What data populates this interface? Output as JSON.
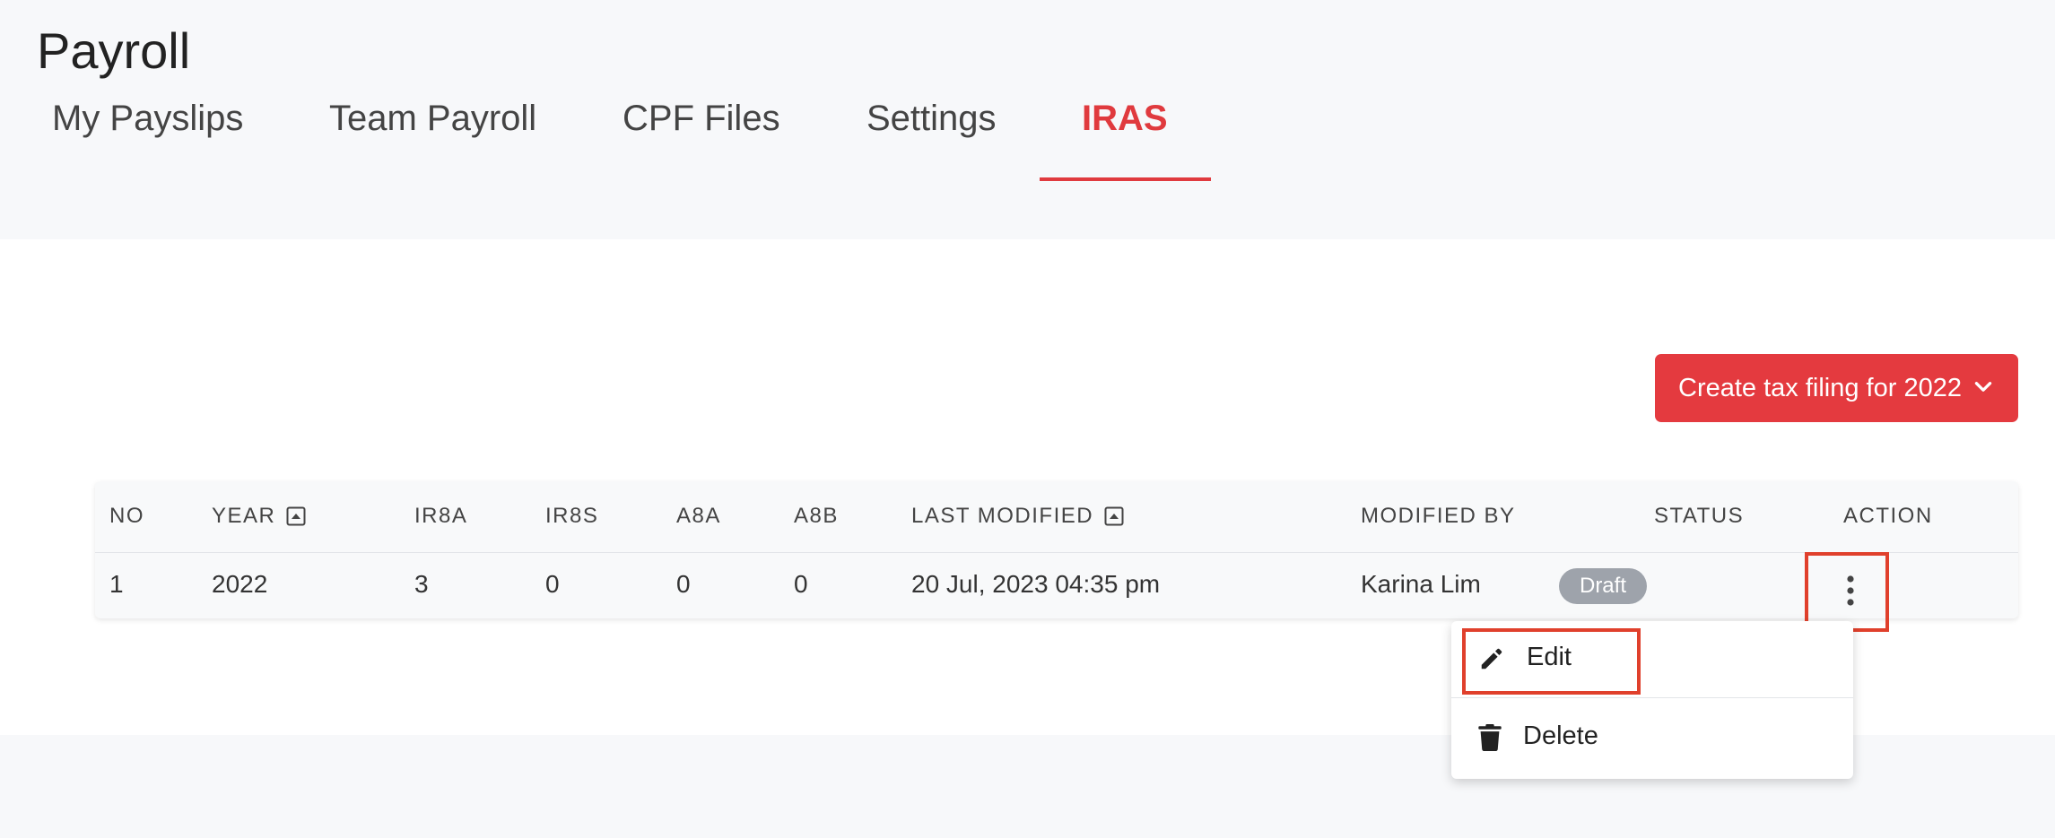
{
  "page": {
    "title": "Payroll"
  },
  "tabs": [
    {
      "label": "My Payslips"
    },
    {
      "label": "Team Payroll"
    },
    {
      "label": "CPF Files"
    },
    {
      "label": "Settings"
    },
    {
      "label": "IRAS",
      "active": true
    }
  ],
  "actions": {
    "create_label": "Create tax filing for 2022"
  },
  "table": {
    "headers": [
      "NO",
      "YEAR",
      "IR8A",
      "IR8S",
      "A8A",
      "A8B",
      "LAST MODIFIED",
      "MODIFIED BY",
      "STATUS",
      "ACTION"
    ],
    "rows": [
      {
        "no": "1",
        "year": "2022",
        "ir8a": "3",
        "ir8s": "0",
        "a8a": "0",
        "a8b": "0",
        "last_modified": "20 Jul, 2023 04:35 pm",
        "modified_by": "Karina Lim",
        "status": "Draft"
      }
    ]
  },
  "menu": {
    "edit_label": "Edit",
    "delete_label": "Delete"
  },
  "colors": {
    "accent": "#e43a3f",
    "badge": "#9ea3ab",
    "highlight": "#e0402c"
  }
}
